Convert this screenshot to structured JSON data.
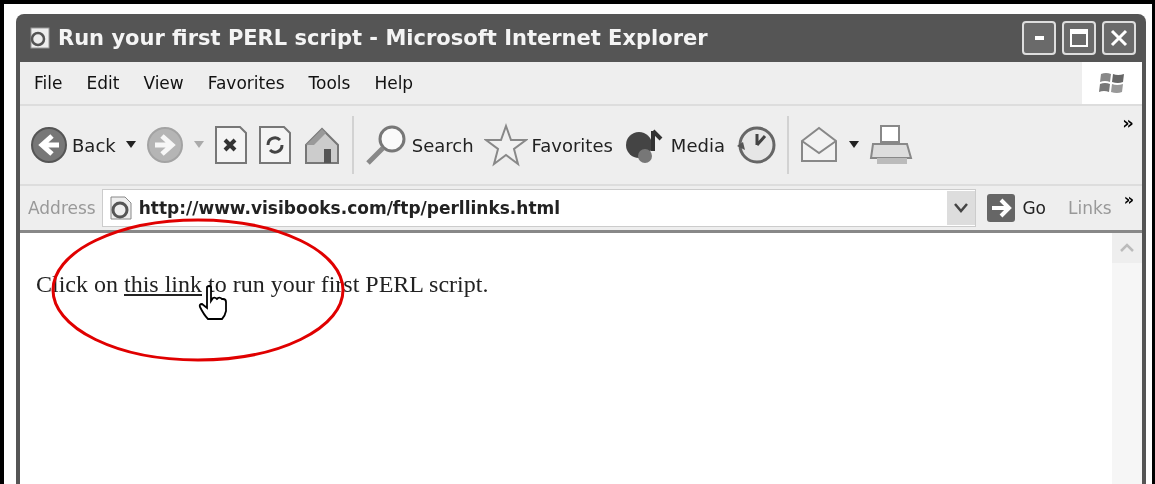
{
  "window": {
    "title": "Run your first PERL script - Microsoft Internet Explorer"
  },
  "menu": [
    "File",
    "Edit",
    "View",
    "Favorites",
    "Tools",
    "Help"
  ],
  "toolbar": [
    {
      "kind": "back",
      "label": "Back",
      "dropdown": true,
      "disabled": false
    },
    {
      "kind": "forward",
      "dropdown": true,
      "disabled": true
    },
    {
      "kind": "stop",
      "dropdown": false,
      "disabled": false
    },
    {
      "kind": "refresh",
      "dropdown": false,
      "disabled": false
    },
    {
      "kind": "home",
      "dropdown": false,
      "disabled": false
    },
    {
      "kind": "separator"
    },
    {
      "kind": "search",
      "label": "Search",
      "dropdown": false,
      "disabled": false
    },
    {
      "kind": "favorites",
      "label": "Favorites",
      "dropdown": false,
      "disabled": false
    },
    {
      "kind": "media",
      "label": "Media",
      "dropdown": false,
      "disabled": false
    },
    {
      "kind": "history",
      "dropdown": false,
      "disabled": false
    },
    {
      "kind": "separator"
    },
    {
      "kind": "mail",
      "dropdown": true,
      "disabled": false
    },
    {
      "kind": "print",
      "dropdown": false,
      "disabled": false
    }
  ],
  "toolbar_more": "»",
  "address_bar": {
    "label": "Address",
    "value": "http://www.visibooks.com/ftp/perllinks.html",
    "go": "Go",
    "links": "Links",
    "links_more": "»"
  },
  "page": {
    "before": "Click on ",
    "link": "this link",
    "after": " to run your first PERL script."
  },
  "annotation": {
    "kind": "ellipse",
    "color": "#e00000"
  }
}
